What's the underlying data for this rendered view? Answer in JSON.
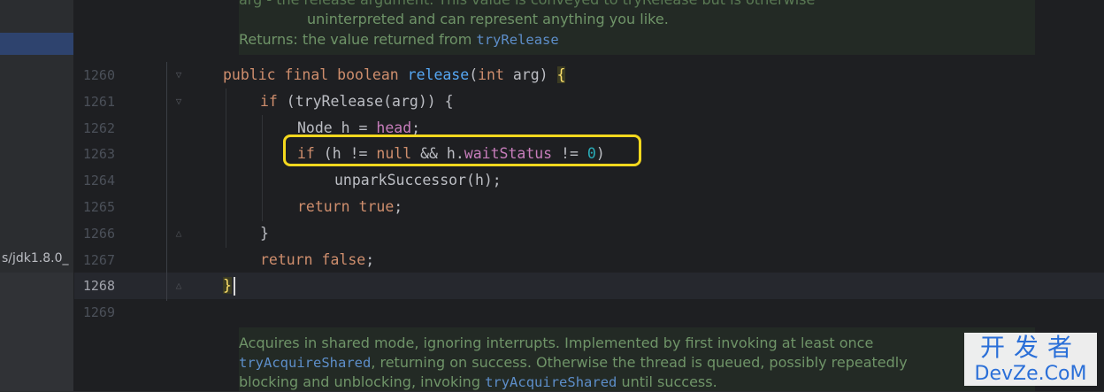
{
  "sidebar": {
    "path_label": "s/jdk1.8.0_"
  },
  "doc_top": {
    "line1_text": "arg - the release argument. This value is conveyed to tryRelease but is otherwise",
    "line2_text": "uninterpreted and can represent anything you like.",
    "returns_label": "Returns:",
    "returns_text": "the value returned from",
    "returns_ref": "tryRelease"
  },
  "editor": {
    "lines": [
      {
        "number": "1260",
        "text": "public final boolean release(int arg) {"
      },
      {
        "number": "1261",
        "text": "if (tryRelease(arg)) {"
      },
      {
        "number": "1262",
        "text": "Node h = head;"
      },
      {
        "number": "1263",
        "text": "if (h != null && h.waitStatus != 0)"
      },
      {
        "number": "1264",
        "text": "unparkSuccessor(h);"
      },
      {
        "number": "1265",
        "text": "return true;"
      },
      {
        "number": "1266",
        "text": "}"
      },
      {
        "number": "1267",
        "text": "return false;"
      },
      {
        "number": "1268",
        "text": "}"
      },
      {
        "number": "1269",
        "text": ""
      }
    ],
    "current_line": "1268",
    "highlight_color": "#f4d81e"
  },
  "doc_bottom": {
    "line1_text": "Acquires in shared mode, ignoring interrupts. Implemented by first invoking at least once",
    "line2_ref": "tryAcquireShared",
    "line2_text": ", returning on success. Otherwise the thread is queued, possibly repeatedly",
    "line3_text_a": "blocking and unblocking, invoking",
    "line3_ref": "tryAcquireShared",
    "line3_text_b": "until success."
  },
  "watermark": {
    "chinese": "开发者",
    "english": "DevZe.CoM"
  }
}
